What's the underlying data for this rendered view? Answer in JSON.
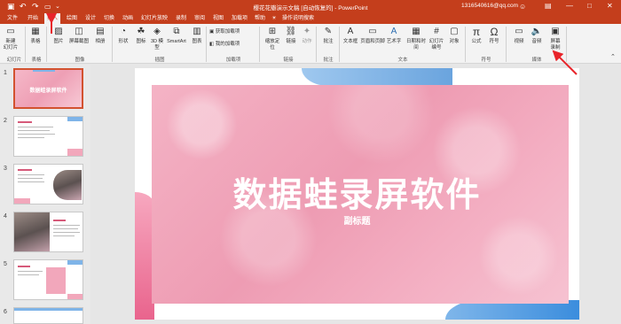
{
  "titlebar": {
    "save_icon": "save-icon",
    "undo_icon": "undo-icon",
    "redo_icon": "redo-icon",
    "title": "樱花花瓣演示文稿 [自动恢复的] - PowerPoint",
    "account": "1316540616@qq.com",
    "account_icon": "user-icon",
    "colors": {
      "bar": "#c43e1c"
    }
  },
  "tabs": [
    "文件",
    "开始",
    "插入",
    "绘图",
    "设计",
    "切换",
    "动画",
    "幻灯片放映",
    "录制",
    "审阅",
    "视图",
    "加载项",
    "帮助",
    "操作说明搜索"
  ],
  "active_tab": "插入",
  "ribbon": {
    "buttons": [
      {
        "label": "新建\n幻灯片",
        "icon": "new-slide-icon"
      },
      {
        "label": "表格",
        "icon": "table-icon"
      },
      {
        "label": "图片",
        "icon": "picture-icon"
      },
      {
        "label": "屏幕截图",
        "icon": "screenshot-icon"
      },
      {
        "label": "相册",
        "icon": "album-icon"
      },
      {
        "label": "形状",
        "icon": "shapes-icon"
      },
      {
        "label": "图标",
        "icon": "icons-icon"
      },
      {
        "label": "3D 模\n型",
        "icon": "3d-model-icon"
      },
      {
        "label": "SmartArt",
        "icon": "smartart-icon"
      },
      {
        "label": "图表",
        "icon": "chart-icon"
      },
      {
        "label": "获取加载项",
        "icon": "store-icon"
      },
      {
        "label": "我的加载项",
        "icon": "my-addins-icon"
      },
      {
        "label": "缩放定\n位",
        "icon": "zoom-icon"
      },
      {
        "label": "链接",
        "icon": "link-icon"
      },
      {
        "label": "动作",
        "icon": "action-icon"
      },
      {
        "label": "批注",
        "icon": "comment-icon"
      },
      {
        "label": "文本框",
        "icon": "textbox-icon"
      },
      {
        "label": "页眉和页脚",
        "icon": "header-footer-icon"
      },
      {
        "label": "艺术字",
        "icon": "wordart-icon"
      },
      {
        "label": "日期和时间",
        "icon": "datetime-icon"
      },
      {
        "label": "幻灯片\n编号",
        "icon": "slide-number-icon"
      },
      {
        "label": "对象",
        "icon": "object-icon"
      },
      {
        "label": "公式",
        "icon": "equation-icon"
      },
      {
        "label": "符号",
        "icon": "symbol-icon"
      },
      {
        "label": "视频",
        "icon": "video-icon"
      },
      {
        "label": "音频",
        "icon": "audio-icon"
      },
      {
        "label": "屏幕\n录制",
        "icon": "screen-record-icon"
      }
    ],
    "groups": [
      "幻灯片",
      "表格",
      "图像",
      "插图",
      "加载项",
      "链接",
      "批注",
      "文本",
      "符号",
      "媒体"
    ]
  },
  "thumbnails": [
    {
      "number": "1",
      "title": "数据蛙录屏软件"
    },
    {
      "number": "2"
    },
    {
      "number": "3"
    },
    {
      "number": "4"
    },
    {
      "number": "5"
    },
    {
      "number": "6"
    }
  ],
  "slide": {
    "title": "数据蛙录屏软件",
    "subtitle": "副标题"
  }
}
